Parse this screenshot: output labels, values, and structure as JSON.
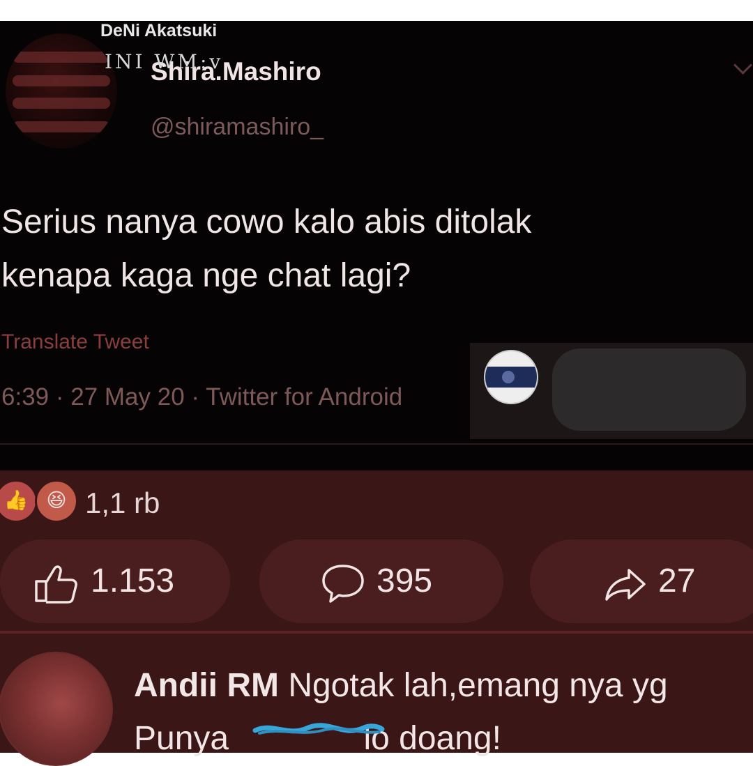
{
  "tweet": {
    "name": "Shira.Mashiro",
    "handle": "@shiramashiro_",
    "text": "Serius nanya cowo kalo abis ditolak\nkenapa kaga nge chat lagi?",
    "translate_label": "Translate Tweet",
    "meta": "6:39 · 27 May 20 · Twitter for Android"
  },
  "watermark": {
    "name": "DeNi Akatsuki",
    "text": "INI WM:v"
  },
  "facebook": {
    "reactions": {
      "icons": [
        "like-icon",
        "haha-icon"
      ],
      "count": "1,1 rb"
    },
    "actions": {
      "like_count": "1.153",
      "comment_count": "395",
      "share_count": "27"
    },
    "comment": {
      "author": "Andii RM",
      "text_line1": "Ngotak lah,emang nya yg",
      "text_pre": "Punya ",
      "text_post": "lo doang!"
    }
  },
  "colors": {
    "tweet_bg": "#050304",
    "fb_bg": "#3a1616",
    "pill_bg": "#4a1e1e",
    "scribble": "#37a6d9"
  }
}
